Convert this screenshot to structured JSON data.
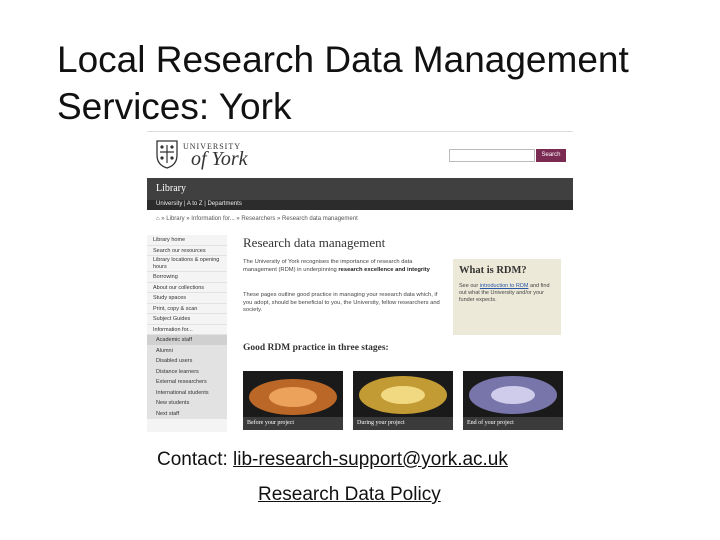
{
  "slide": {
    "title_line1": "Local Research Data Management",
    "title_line2": "Services: York",
    "contact_label": "Contact:",
    "contact_email": "lib-research-support@york.ac.uk",
    "policy_link": "Research Data Policy"
  },
  "website": {
    "logo_top": "UNIVERSITY",
    "logo_main": "of York",
    "search_placeholder": "",
    "search_button": "Search",
    "section_title": "Library",
    "subnav": "University | A to Z | Departments",
    "breadcrumb": "» Library » Information for... » Researchers » Research data management",
    "sidebar": [
      {
        "label": "Library home",
        "type": "item"
      },
      {
        "label": "Search our resources",
        "type": "item"
      },
      {
        "label": "Library locations & opening hours",
        "type": "tall"
      },
      {
        "label": "Borrowing",
        "type": "item"
      },
      {
        "label": "About our collections",
        "type": "item"
      },
      {
        "label": "Study spaces",
        "type": "item"
      },
      {
        "label": "Print, copy & scan",
        "type": "item"
      },
      {
        "label": "Subject Guides",
        "type": "item"
      },
      {
        "label": "Information for...",
        "type": "item"
      },
      {
        "label": "Academic staff",
        "type": "sub"
      },
      {
        "label": "Alumni",
        "type": "sub"
      },
      {
        "label": "Disabled users",
        "type": "sub"
      },
      {
        "label": "Distance learners",
        "type": "sub"
      },
      {
        "label": "External researchers",
        "type": "sub"
      },
      {
        "label": "International students",
        "type": "sub"
      },
      {
        "label": "New students",
        "type": "sub"
      },
      {
        "label": "Next staff",
        "type": "sub"
      }
    ],
    "page_heading": "Research data management",
    "intro_p1": "The University of York recognises the importance of research data management (RDM) in underpinning",
    "intro_p1_bold": "research excellence and integrity",
    "intro_p2": "These pages outline good practice in managing your research data which, if you adopt, should be beneficial to you, the University, fellow researchers and society.",
    "rdm_box_title": "What is RDM?",
    "rdm_box_pre": "See our",
    "rdm_box_link": "introduction to RDM",
    "rdm_box_post": "and find out what the University and/or your funder expects.",
    "practice_heading": "Good RDM practice in three stages:",
    "stages": [
      {
        "caption": "Before your project",
        "color": "#d8762a"
      },
      {
        "caption": "During your project",
        "color": "#e2b33a"
      },
      {
        "caption": "End of your project",
        "color": "#8a86c6"
      }
    ]
  }
}
